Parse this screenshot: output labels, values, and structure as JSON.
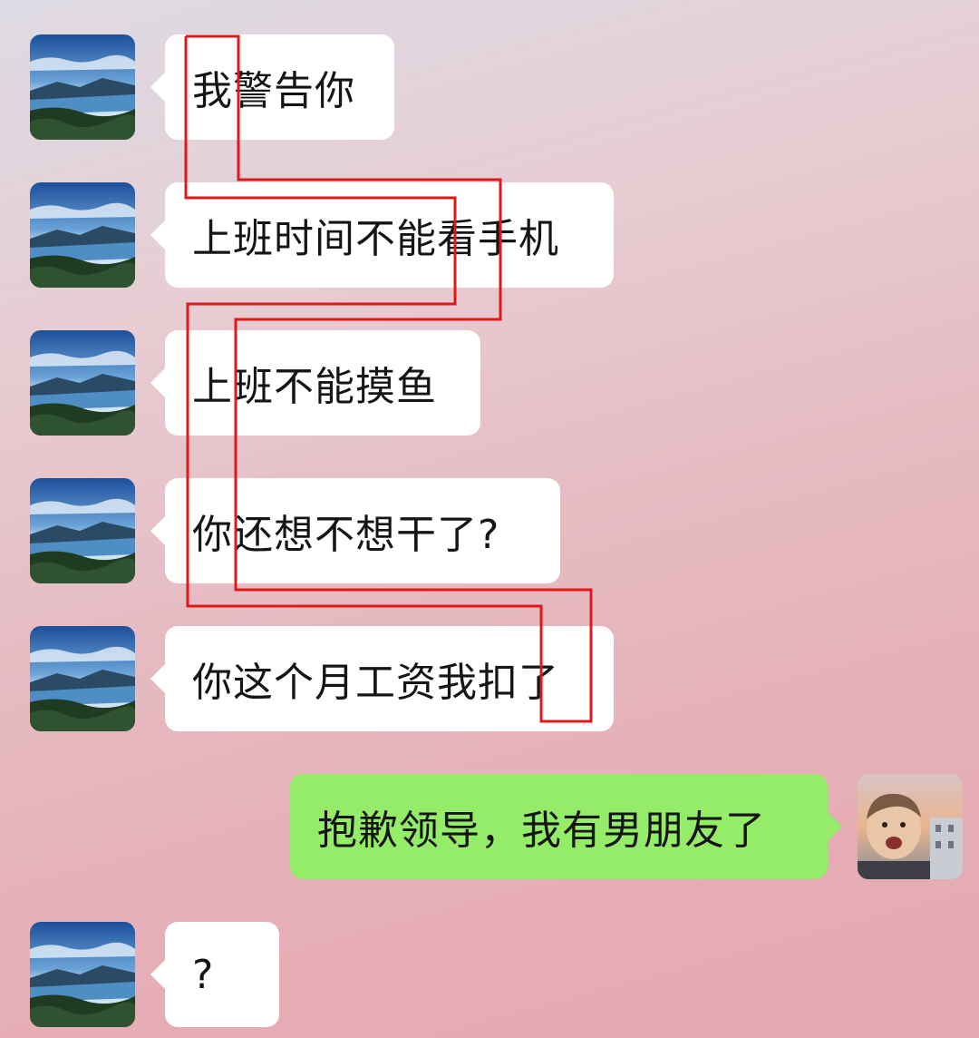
{
  "messages": [
    {
      "sender": "boss",
      "text": "我警告你"
    },
    {
      "sender": "boss",
      "text": "上班时间不能看手机"
    },
    {
      "sender": "boss",
      "text": "上班不能摸鱼"
    },
    {
      "sender": "boss",
      "text": "你还想不想干了?"
    },
    {
      "sender": "boss",
      "text": "你这个月工资我扣了"
    },
    {
      "sender": "me",
      "text": "抱歉领导，我有男朋友了"
    },
    {
      "sender": "boss",
      "text": "?"
    }
  ],
  "avatars": {
    "boss": "landscape-lake-avatar",
    "me": "baby-photo-avatar"
  },
  "colors": {
    "incoming_bubble": "#ffffff",
    "outgoing_bubble": "#95ec69",
    "annotation_line": "#e01818"
  }
}
